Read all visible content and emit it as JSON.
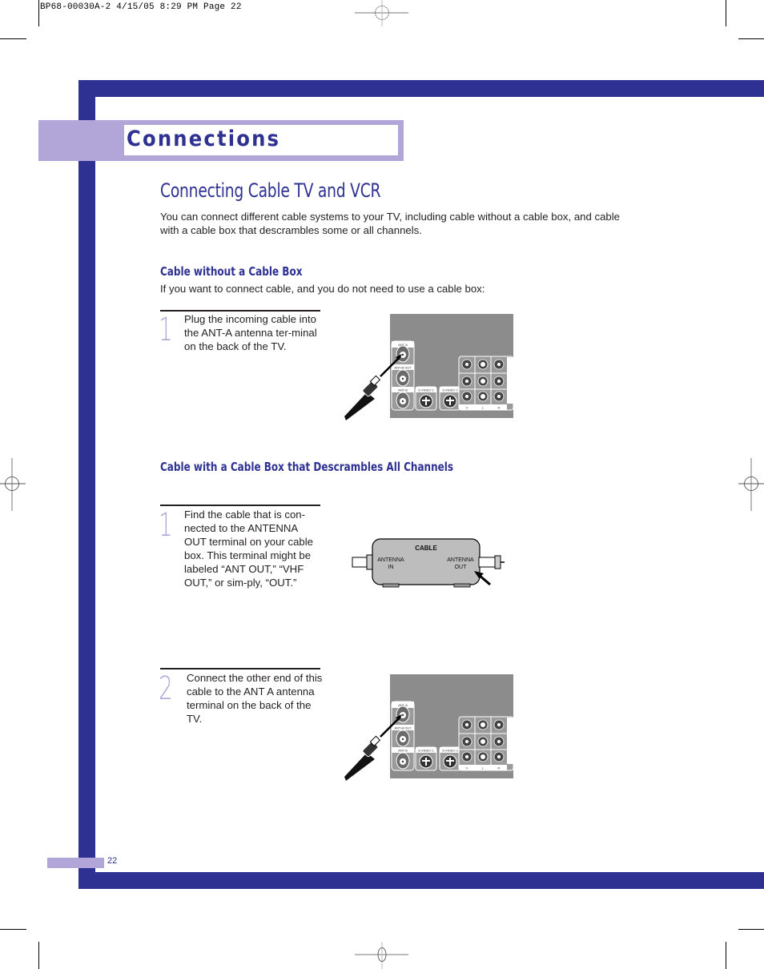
{
  "slug": "BP68-00030A-2   4/15/05   8:29 PM   Page 22",
  "section_title": "Connections",
  "heading": "Connecting Cable TV and VCR",
  "intro": "You can connect different cable systems to your TV, including cable without a cable box, and cable with a cable box that descrambles some or all channels.",
  "sub1": {
    "title": "Cable without a Cable Box",
    "intro": "If you want to connect cable, and you do not need to use a cable box:",
    "steps": [
      {
        "num": "1",
        "text": "Plug the incoming cable into the ANT-A antenna ter-minal on the back of the TV."
      }
    ]
  },
  "sub2": {
    "title": "Cable with a Cable Box that Descrambles All Channels",
    "steps": [
      {
        "num": "1",
        "text": "Find the cable that is con-nected to the ANTENNA OUT terminal on your cable box. This terminal might be labeled “ANT OUT,”  “VHF OUT,” or sim-ply, “OUT.”"
      },
      {
        "num": "2",
        "text": "Connect the other end of this cable to the ANT A antenna terminal on the back of the TV."
      }
    ]
  },
  "tv_panel": {
    "ant_a": "ANT-A",
    "ant_b_out": "ANT-B OUT",
    "ant_b": "ANT-B",
    "svideo1": "S-VIDEO 1",
    "svideo2": "S-VIDEO 2",
    "col_labels": [
      "V",
      "L",
      "R"
    ]
  },
  "cable_box": {
    "label": "CABLE",
    "in_label_1": "ANTENNA",
    "in_label_2": "IN",
    "out_label_1": "ANTENNA",
    "out_label_2": "OUT"
  },
  "page_number": "22",
  "colors": {
    "brand_blue": "#2e3192",
    "lavender": "#b2a6d9",
    "panel_gray": "#8c8c8c"
  }
}
